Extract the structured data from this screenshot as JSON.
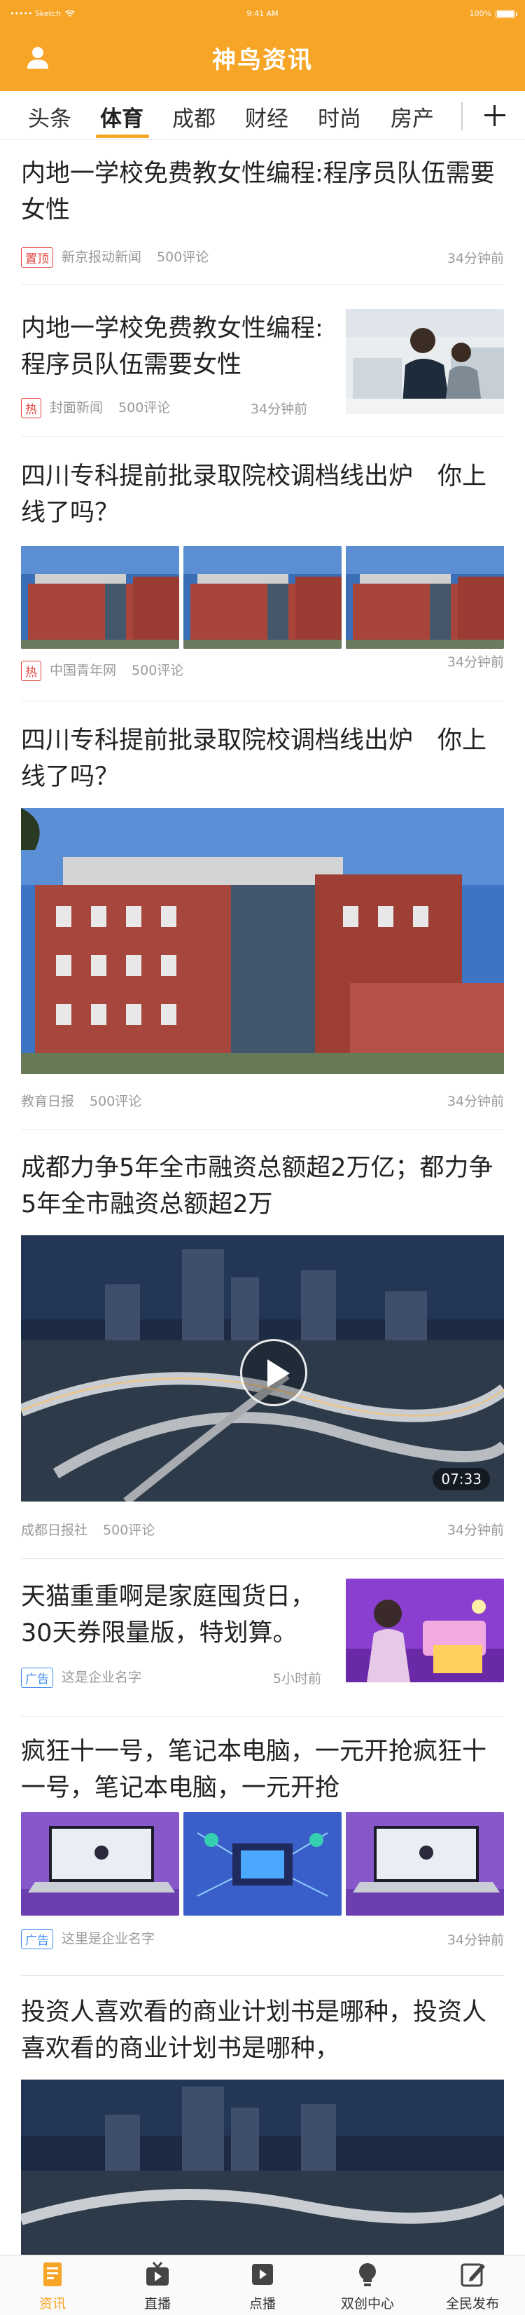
{
  "status_bar": {
    "carrier": "••••• Sketch",
    "time": "9:41 AM",
    "battery": "100%",
    "battery_level": 1.0
  },
  "header": {
    "title": "神鸟资讯",
    "accent_color": "#f7a526"
  },
  "tabs": [
    {
      "label": "头条"
    },
    {
      "label": "体育"
    },
    {
      "label": "成都"
    },
    {
      "label": "财经"
    },
    {
      "label": "时尚"
    },
    {
      "label": "房产"
    }
  ],
  "active_tab": "体育",
  "feed": [
    {
      "title": "内地一学校免费教女性编程:程序员队伍需要女性",
      "tag": "置顶",
      "source": "新京报动新闻",
      "comments": "500评论",
      "time": "34分钟前"
    },
    {
      "title": "内地一学校免费教女性编程:程序员队伍需要女性",
      "tag": "热",
      "source": "封面新闻",
      "comments": "500评论",
      "time": "34分钟前"
    },
    {
      "title": "四川专科提前批录取院校调档线出炉　你上线了吗？",
      "tag": "热",
      "source": "中国青年网",
      "comments": "500评论",
      "time": "34分钟前"
    },
    {
      "title": "四川专科提前批录取院校调档线出炉　你上线了吗？",
      "source": "教育日报",
      "comments": "500评论",
      "time": "34分钟前"
    },
    {
      "title": "成都力争5年全市融资总额超2万亿；都力争5年全市融资总额超2万",
      "source": "成都日报社",
      "comments": "500评论",
      "time": "34分钟前",
      "duration": "07:33"
    },
    {
      "title": "天猫重重啊是家庭囤货日，30天券限量版，特划算。",
      "tag": "广告",
      "source": "这是企业名字",
      "time": "5小时前"
    },
    {
      "title": "疯狂十一号，笔记本电脑，一元开抢疯狂十一号，笔记本电脑，一元开抢",
      "tag": "广告",
      "source": "这里是企业名字",
      "time": "34分钟前"
    },
    {
      "title": "投资人喜欢看的商业计划书是哪种，投资人喜欢看的商业计划书是哪种，",
      "source": "",
      "time": ""
    }
  ],
  "tabbar": [
    {
      "label": "资讯",
      "icon": "news-icon"
    },
    {
      "label": "直播",
      "icon": "live-tv-icon"
    },
    {
      "label": "点播",
      "icon": "play-icon"
    },
    {
      "label": "双创中心",
      "icon": "lightbulb-icon"
    },
    {
      "label": "全民发布",
      "icon": "edit-icon"
    }
  ]
}
